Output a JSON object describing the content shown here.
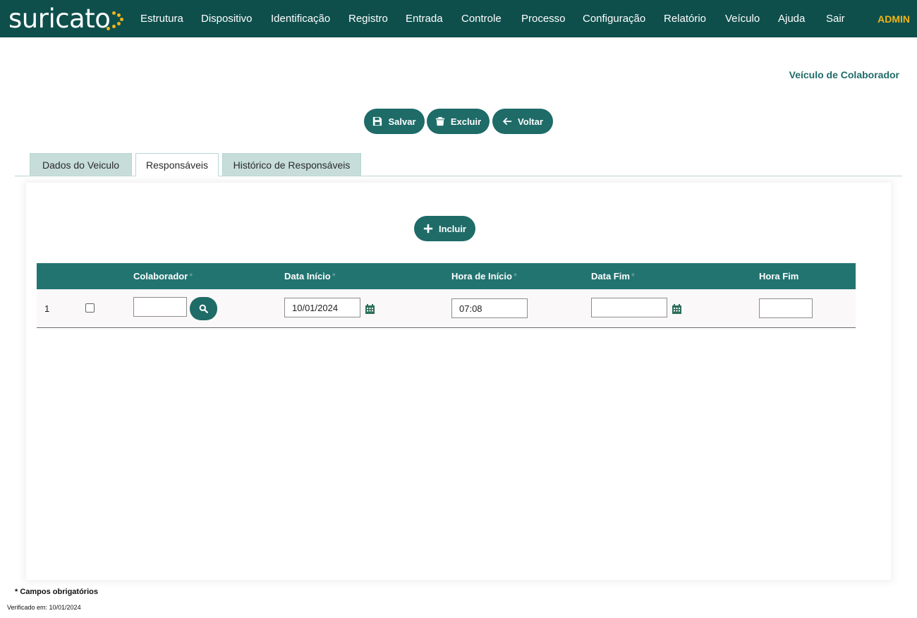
{
  "brand": {
    "logo_text": "suricato",
    "accent": "#f2b418",
    "primary": "#1e6b68",
    "header_bg": "#0e4f4c"
  },
  "nav": {
    "items": [
      "Estrutura",
      "Dispositivo",
      "Identificação",
      "Registro",
      "Entrada",
      "Controle",
      "Processo",
      "Configuração",
      "Relatório",
      "Veículo",
      "Ajuda",
      "Sair"
    ],
    "user": "ADMIN"
  },
  "page": {
    "title": "Veículo de Colaborador"
  },
  "actions": {
    "save": "Salvar",
    "delete": "Excluir",
    "back": "Voltar"
  },
  "tabs": [
    {
      "label": "Dados do Veiculo",
      "active": false
    },
    {
      "label": "Responsáveis",
      "active": true
    },
    {
      "label": "Histórico de Responsáveis",
      "active": false
    }
  ],
  "panel": {
    "add_label": "Incluir"
  },
  "table": {
    "columns": [
      {
        "label": "Colaborador",
        "required": "*"
      },
      {
        "label": "Data Início",
        "required": "*"
      },
      {
        "label": "Hora de Início",
        "required": "*"
      },
      {
        "label": "Data Fim",
        "required": "*"
      },
      {
        "label": "Hora Fim",
        "required": ""
      }
    ],
    "rows": [
      {
        "index": "1",
        "selected": false,
        "colaborador": "",
        "data_inicio": "10/01/2024",
        "hora_inicio": "07:08",
        "data_fim": "",
        "hora_fim": ""
      }
    ]
  },
  "footer": {
    "required_note": "* Campos obrigatórios",
    "verified": "Verificado em: 10/01/2024"
  }
}
